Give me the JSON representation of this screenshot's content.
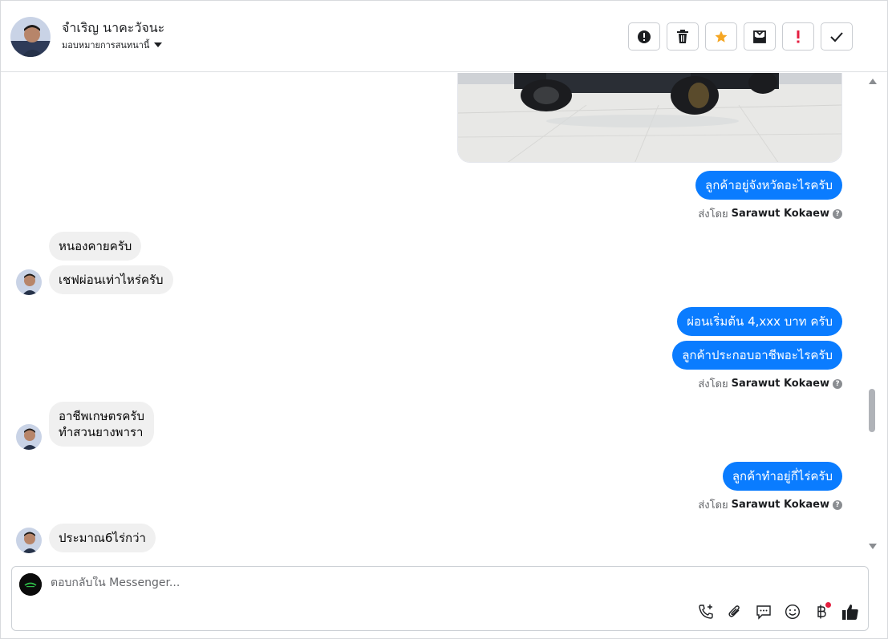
{
  "header": {
    "name": "จำเริญ นาคะวัจนะ",
    "assign_label": "มอบหมายการสนทนานี้",
    "actions": [
      {
        "id": "spam",
        "icon": "alert-circle-icon"
      },
      {
        "id": "delete",
        "icon": "trash-icon"
      },
      {
        "id": "star",
        "icon": "star-icon"
      },
      {
        "id": "unread",
        "icon": "mail-icon"
      },
      {
        "id": "important",
        "icon": "exclamation-icon"
      },
      {
        "id": "done",
        "icon": "check-icon"
      }
    ]
  },
  "messages": {
    "out1": "ลูกค้าอยู่จังหวัดอะไรครับ",
    "in1": "หนองคายครับ",
    "in2": "เชฟผ่อนเท่าไหร่ครับ",
    "out2": "ผ่อนเริ่มต้น 4,xxx บาท ครับ",
    "out3": "ลูกค้าประกอบอาชีพอะไรครับ",
    "in3_line1": "อาชีพเกษตรครับ",
    "in3_line2": "ทำสวนยางพารา",
    "out4": "ลูกค้าทำอยู่กี่ไร่ครับ",
    "in4": "ประมาณ6ไร่กว่า"
  },
  "sent_by": {
    "prefix": "ส่งโดย",
    "agent": "Sarawut Kokaew"
  },
  "composer": {
    "placeholder": "ตอบกลับใน Messenger...",
    "tools": [
      "phone-plus-icon",
      "paperclip-icon",
      "chat-bubble-icon",
      "emoji-icon",
      "baht-icon",
      "thumbs-up-icon"
    ]
  },
  "colors": {
    "outgoing_bubble": "#0a7cff",
    "incoming_bubble": "#f0f0f0",
    "star": "#f5a623"
  }
}
